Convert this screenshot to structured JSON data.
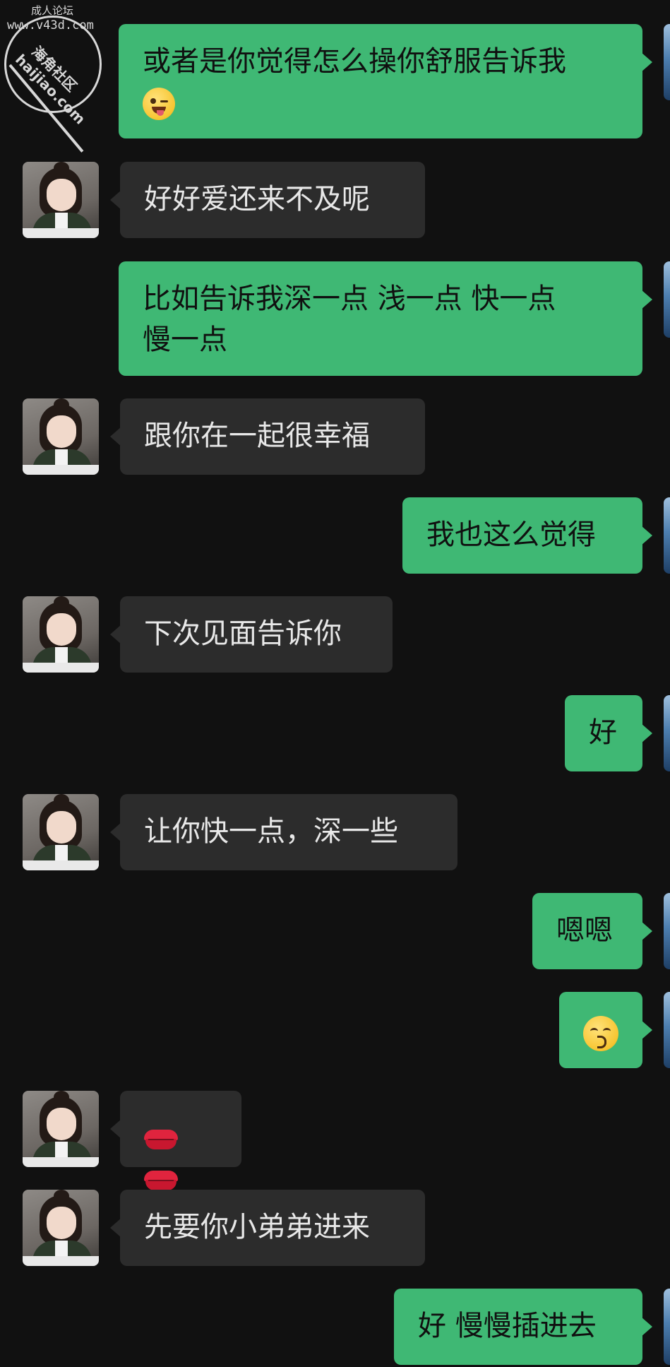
{
  "watermark": {
    "top_text": "成人论坛",
    "url": "www.v43d.com",
    "cn_text": "海角社区",
    "domain": "haijiao.com"
  },
  "messages": [
    {
      "side": "out",
      "text": "或者是你觉得怎么操你舒服告诉我",
      "emoji": "winking-tongue-emoji"
    },
    {
      "side": "in",
      "text": "好好爱还来不及呢"
    },
    {
      "side": "out",
      "text": "比如告诉我深一点 浅一点 快一点\n慢一点"
    },
    {
      "side": "in",
      "text": "跟你在一起很幸福"
    },
    {
      "side": "out",
      "text": "我也这么觉得"
    },
    {
      "side": "in",
      "text": "下次见面告诉你"
    },
    {
      "side": "out",
      "text": "好"
    },
    {
      "side": "in",
      "text": "让你快一点，深一些"
    },
    {
      "side": "out",
      "text": "嗯嗯"
    },
    {
      "side": "out",
      "text": "",
      "emoji": "kissing-smiling-eyes-emoji"
    },
    {
      "side": "in",
      "text": "",
      "emoji": "lips-emoji"
    },
    {
      "side": "in",
      "text": "先要你小弟弟进来"
    },
    {
      "side": "out",
      "text": "好 慢慢插进去"
    }
  ]
}
